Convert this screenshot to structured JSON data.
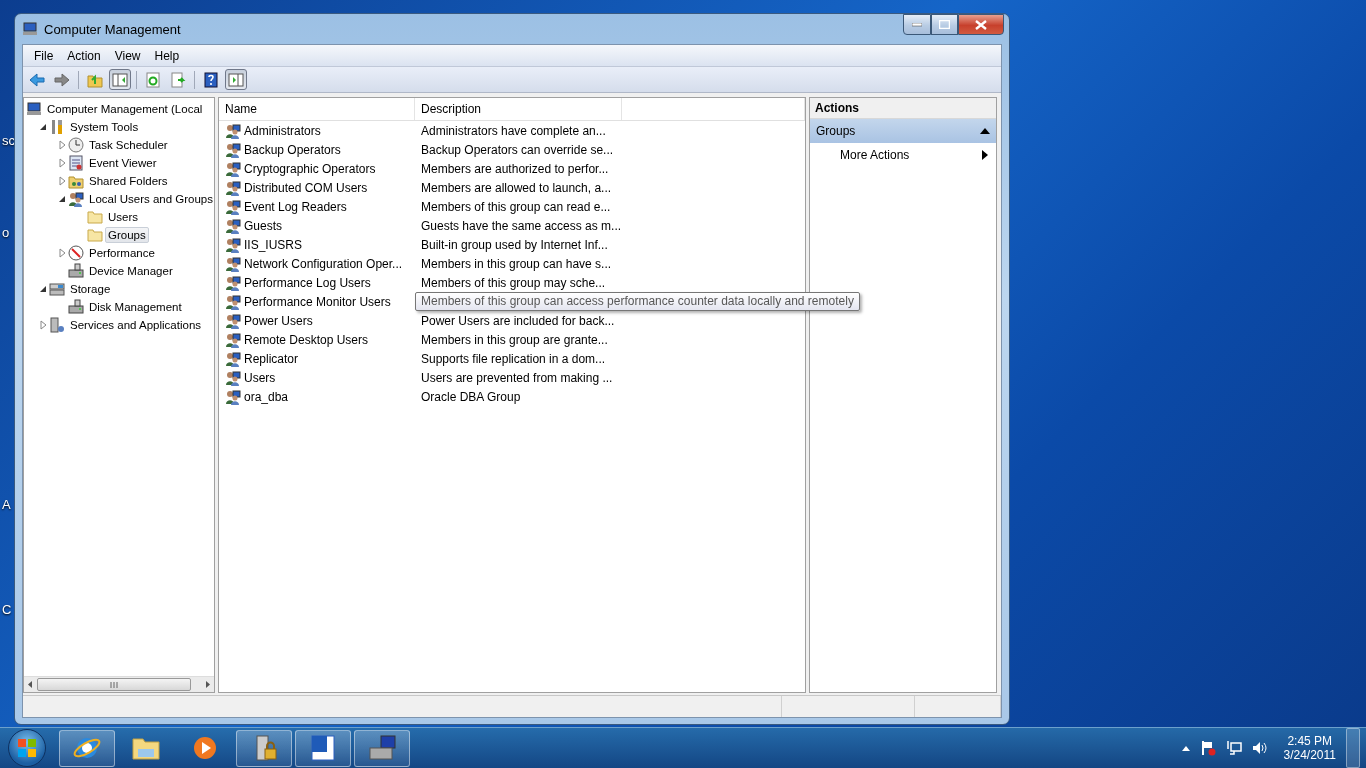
{
  "desktop_fragments": [
    "sc",
    "o",
    "A",
    "C"
  ],
  "window": {
    "title": "Computer Management"
  },
  "menu": [
    "File",
    "Action",
    "View",
    "Help"
  ],
  "toolbar": [
    {
      "kind": "back",
      "pressed": false
    },
    {
      "kind": "forward",
      "pressed": false
    },
    {
      "kind": "sep"
    },
    {
      "kind": "up",
      "pressed": false
    },
    {
      "kind": "tree",
      "pressed": true
    },
    {
      "kind": "sep"
    },
    {
      "kind": "refresh",
      "pressed": false
    },
    {
      "kind": "export",
      "pressed": false
    },
    {
      "kind": "sep"
    },
    {
      "kind": "help",
      "pressed": false
    },
    {
      "kind": "actionpane",
      "pressed": true
    }
  ],
  "tree": [
    {
      "label": "Computer Management (Local",
      "kind": "computer",
      "selected": false,
      "children": [
        {
          "label": "System Tools",
          "kind": "tools",
          "expanded": true,
          "selected": false,
          "children": [
            {
              "label": "Task Scheduler",
              "kind": "clock",
              "expanded": false,
              "selected": false
            },
            {
              "label": "Event Viewer",
              "kind": "log",
              "expanded": false,
              "selected": false
            },
            {
              "label": "Shared Folders",
              "kind": "share",
              "expanded": false,
              "selected": false
            },
            {
              "label": "Local Users and Groups",
              "kind": "users",
              "expanded": true,
              "selected": false,
              "children": [
                {
                  "label": "Users",
                  "kind": "folder",
                  "selected": false
                },
                {
                  "label": "Groups",
                  "kind": "folder",
                  "selected": true
                }
              ]
            },
            {
              "label": "Performance",
              "kind": "gauge",
              "expanded": false,
              "selected": false
            },
            {
              "label": "Device Manager",
              "kind": "device",
              "selected": false
            }
          ]
        },
        {
          "label": "Storage",
          "kind": "storage",
          "expanded": true,
          "selected": false,
          "children": [
            {
              "label": "Disk Management",
              "kind": "device",
              "selected": false
            }
          ]
        },
        {
          "label": "Services and Applications",
          "kind": "services",
          "expanded": false,
          "selected": false
        }
      ]
    }
  ],
  "list": {
    "columns": [
      "Name",
      "Description"
    ],
    "rows": [
      {
        "name": "Administrators",
        "description": "Administrators have complete an..."
      },
      {
        "name": "Backup Operators",
        "description": "Backup Operators can override se..."
      },
      {
        "name": "Cryptographic Operators",
        "description": "Members are authorized to perfor..."
      },
      {
        "name": "Distributed COM Users",
        "description": "Members are allowed to launch, a..."
      },
      {
        "name": "Event Log Readers",
        "description": "Members of this group can read e..."
      },
      {
        "name": "Guests",
        "description": "Guests have the same access as m..."
      },
      {
        "name": "IIS_IUSRS",
        "description": "Built-in group used by Internet Inf..."
      },
      {
        "name": "Network Configuration Oper...",
        "description": "Members in this group can have s..."
      },
      {
        "name": "Performance Log Users",
        "description": "Members of this group may sche..."
      },
      {
        "name": "Performance Monitor Users",
        "tooltip": "Members of this group can access performance counter data locally and remotely"
      },
      {
        "name": "Power Users",
        "description": "Power Users are included for back..."
      },
      {
        "name": "Remote Desktop Users",
        "description": "Members in this group are grante..."
      },
      {
        "name": "Replicator",
        "description": "Supports file replication in a dom..."
      },
      {
        "name": "Users",
        "description": "Users are prevented from making ..."
      },
      {
        "name": "ora_dba",
        "description": "Oracle DBA Group"
      }
    ]
  },
  "actions": {
    "title": "Actions",
    "sections": [
      {
        "label": "Groups",
        "expanded": true,
        "items": [
          "More Actions"
        ]
      }
    ]
  },
  "taskbar": {
    "apps": [
      {
        "kind": "browser",
        "running": true
      },
      {
        "kind": "explorer",
        "running": false
      },
      {
        "kind": "media",
        "running": false
      },
      {
        "kind": "server",
        "running": true
      },
      {
        "kind": "word",
        "running": true
      },
      {
        "kind": "management",
        "running": true
      }
    ],
    "time": "2:45 PM",
    "date": "3/24/2011"
  }
}
